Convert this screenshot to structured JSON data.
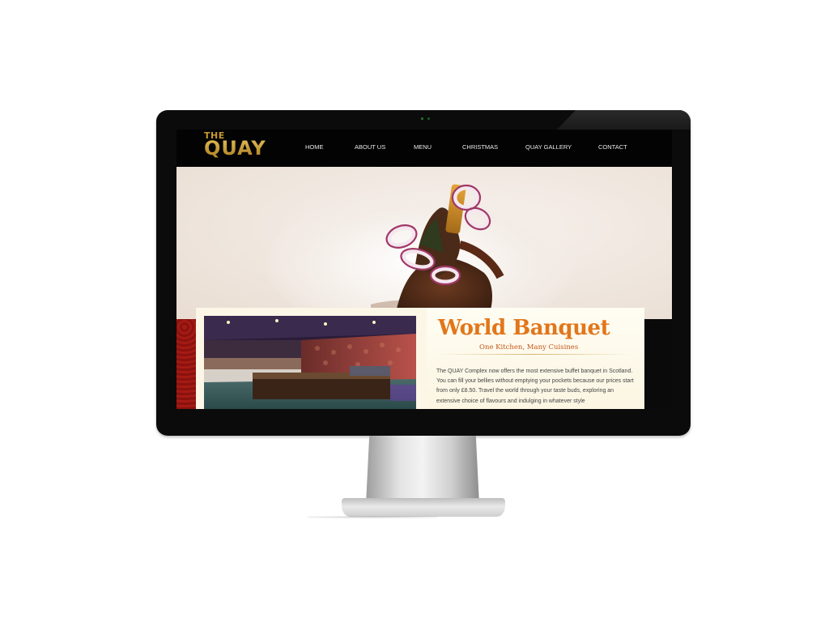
{
  "site": {
    "logo": {
      "small": "THE",
      "large": "QUAY"
    },
    "nav": [
      "HOME",
      "ABOUT US",
      "MENU",
      "CHRISTMAS",
      "QUAY GALLERY",
      "CONTACT"
    ]
  },
  "banquet": {
    "title": "World Banquet",
    "subtitle": "One Kitchen, Many Cuisines",
    "text": "The QUAY Complex now offers the most extensive buffet banquet in Scotland. You can fill your bellies without emptying your pockets because our prices start from only £8.50. Travel the world through your taste buds, exploring an extensive choice of flavours and indulging in whatever style"
  },
  "colors": {
    "accent_orange": "#e2761a",
    "logo_gold": "#c79b31",
    "header_bg": "#030303",
    "strip_red": "#a51a14",
    "panel_cream": "#fbf6e6"
  }
}
